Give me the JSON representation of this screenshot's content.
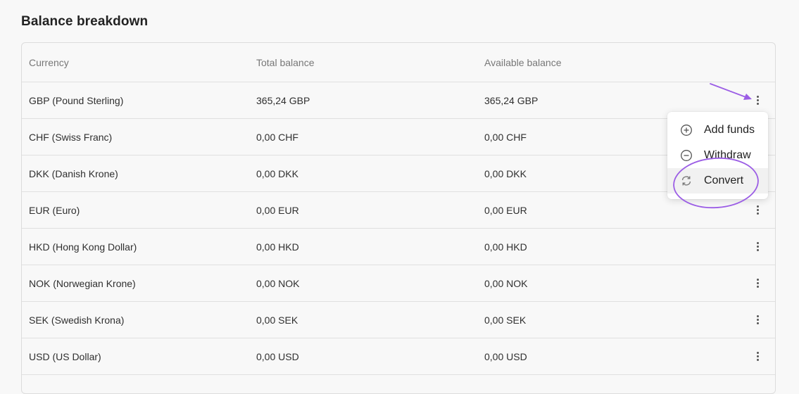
{
  "page": {
    "title": "Balance breakdown"
  },
  "table": {
    "headers": {
      "currency": "Currency",
      "total": "Total balance",
      "available": "Available balance"
    },
    "rows": [
      {
        "currency": "GBP (Pound Sterling)",
        "total": "365,24 GBP",
        "available": "365,24 GBP"
      },
      {
        "currency": "CHF (Swiss Franc)",
        "total": "0,00 CHF",
        "available": "0,00 CHF"
      },
      {
        "currency": "DKK (Danish Krone)",
        "total": "0,00 DKK",
        "available": "0,00 DKK"
      },
      {
        "currency": "EUR (Euro)",
        "total": "0,00 EUR",
        "available": "0,00 EUR"
      },
      {
        "currency": "HKD (Hong Kong Dollar)",
        "total": "0,00 HKD",
        "available": "0,00 HKD"
      },
      {
        "currency": "NOK (Norwegian Krone)",
        "total": "0,00 NOK",
        "available": "0,00 NOK"
      },
      {
        "currency": "SEK (Swedish Krona)",
        "total": "0,00 SEK",
        "available": "0,00 SEK"
      },
      {
        "currency": "USD (US Dollar)",
        "total": "0,00 USD",
        "available": "0,00 USD"
      }
    ]
  },
  "row_menu": {
    "items": [
      {
        "label": "Add funds",
        "icon": "plus-circle-icon"
      },
      {
        "label": "Withdraw",
        "icon": "minus-circle-icon"
      },
      {
        "label": "Convert",
        "icon": "convert-arrows-icon"
      }
    ],
    "highlighted_item": "Convert"
  },
  "annotation": {
    "color": "#9b5de5"
  }
}
